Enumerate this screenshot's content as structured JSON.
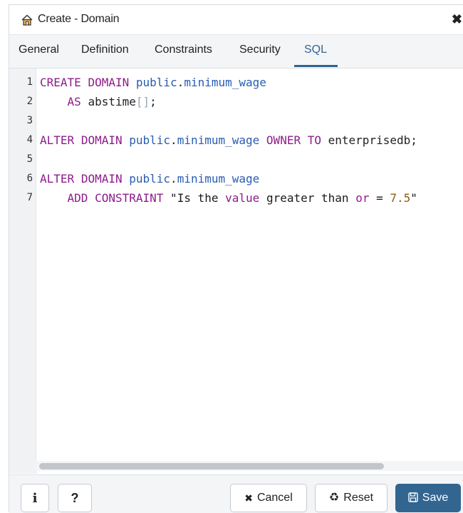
{
  "dialog": {
    "title": "Create - Domain",
    "title_icon": "home-icon",
    "close_glyph": "✖"
  },
  "tabs": [
    {
      "label": "General",
      "active": false
    },
    {
      "label": "Definition",
      "active": false
    },
    {
      "label": "Constraints",
      "active": false
    },
    {
      "label": "Security",
      "active": false
    },
    {
      "label": "SQL",
      "active": true
    }
  ],
  "editor": {
    "lines": [
      {
        "n": "1",
        "code": "CREATE DOMAIN public.minimum_wage"
      },
      {
        "n": "2",
        "code": "    AS abstime[];"
      },
      {
        "n": "3",
        "code": ""
      },
      {
        "n": "4",
        "code": "ALTER DOMAIN public.minimum_wage OWNER TO enterprisedb;"
      },
      {
        "n": "5",
        "code": ""
      },
      {
        "n": "6",
        "code": "ALTER DOMAIN public.minimum_wage"
      },
      {
        "n": "7",
        "code": "    ADD CONSTRAINT \"Is the value greater than or = 7.5\""
      }
    ]
  },
  "footer": {
    "info_label": "i",
    "help_label": "?",
    "cancel_label": "Cancel",
    "reset_label": "Reset",
    "save_label": "Save"
  },
  "colors": {
    "accent": "#326690",
    "keyword": "#8e1c8a",
    "identifier": "#2a5db0"
  }
}
